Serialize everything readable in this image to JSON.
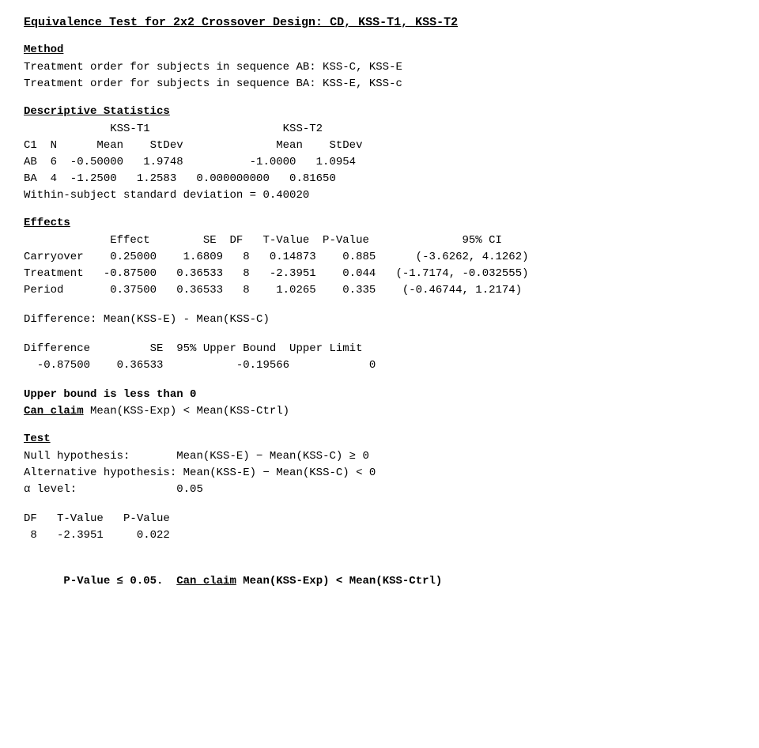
{
  "title": "Equivalence Test for 2x2 Crossover Design: CD, KSS-T1, KSS-T2",
  "method": {
    "header": "Method",
    "line1": "Treatment order for subjects in sequence AB: KSS-C, KSS-E",
    "line2": "Treatment order for subjects in sequence BA: KSS-E, KSS-c"
  },
  "descriptive": {
    "header": "Descriptive Statistics",
    "header_row1": "             KSS-T1                    KSS-T2",
    "header_row2": "C1  N      Mean    StDev              Mean    StDev",
    "data_row1": "AB  6  -0.50000   1.9748          -1.0000   1.0954",
    "data_row2": "BA  4  -1.2500   1.2583   0.000000000   0.81650",
    "within": "Within-subject standard deviation = 0.40020"
  },
  "effects": {
    "header": "Effects",
    "header_row": "             Effect        SE  DF   T-Value  P-Value              95% CI",
    "carryover": "Carryover    0.25000    1.6809   8   0.14873    0.885      (-3.6262, 4.1262)",
    "treatment": "Treatment   -0.87500   0.36533   8   -2.3951    0.044   (-1.7174, -0.032555)",
    "period": "Period       0.37500   0.36533   8    1.0265    0.335    (-0.46744, 1.2174)"
  },
  "difference_label": "Difference: Mean(KSS-E) - Mean(KSS-C)",
  "difference_table": {
    "header": "Difference         SE  95% Upper Bound  Upper Limit",
    "row": "  -0.87500    0.36533           -0.19566            0"
  },
  "upper_bound_note": "Upper bound is less than 0",
  "can_claim_1": "Can claim Mean(KSS-Exp) < Mean(KSS-Ctrl)",
  "test": {
    "header": "Test",
    "null_label": "Null hypothesis:       ",
    "null_value": "Mean(KSS-E) - Mean(KSS-C) ≥ 0",
    "alt_label": "Alternative hypothesis:",
    "alt_value": "Mean(KSS-E) - Mean(KSS-C) < 0",
    "alpha_label": "α level:               ",
    "alpha_value": "0.05"
  },
  "test_results": {
    "header": "DF   T-Value   P-Value",
    "row": " 8   -2.3951     0.022"
  },
  "final_conclusion": "P-Value ≤ 0.05.  Can claim Mean(KSS-Exp) < Mean(KSS-Ctrl)"
}
